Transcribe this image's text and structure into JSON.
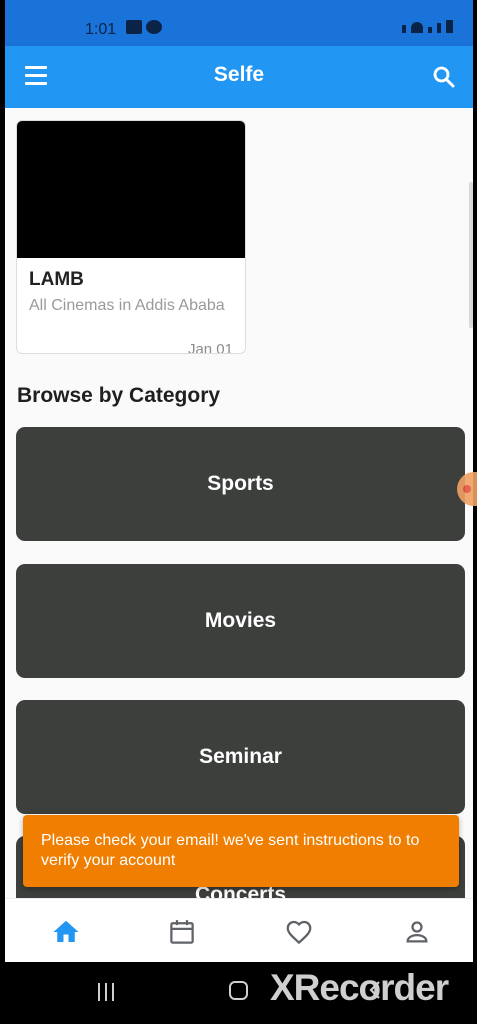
{
  "status_bar": {
    "time": "1:01"
  },
  "app_bar": {
    "title": "Selfe"
  },
  "event": {
    "title": "LAMB",
    "venue": "All Cinemas in Addis Ababa",
    "date": "Jan 01"
  },
  "section": {
    "title": "Browse by Category"
  },
  "categories": [
    {
      "label": "Sports"
    },
    {
      "label": "Movies"
    },
    {
      "label": "Seminar"
    },
    {
      "label": "Concerts"
    }
  ],
  "snackbar": {
    "message": "Please check your email! we've sent instructions to to verify your account"
  },
  "bottom_nav": {
    "items": [
      {
        "icon": "home-icon",
        "active": true
      },
      {
        "icon": "calendar-icon",
        "active": false
      },
      {
        "icon": "heart-icon",
        "active": false
      },
      {
        "icon": "person-icon",
        "active": false
      }
    ],
    "active_color": "#2196f3",
    "inactive_color": "#5f6368"
  },
  "watermark": {
    "text": "XRecorder"
  },
  "colors": {
    "app_bar": "#2196f3",
    "category_tile": "#3d3f3c",
    "snackbar": "#f07e00"
  }
}
